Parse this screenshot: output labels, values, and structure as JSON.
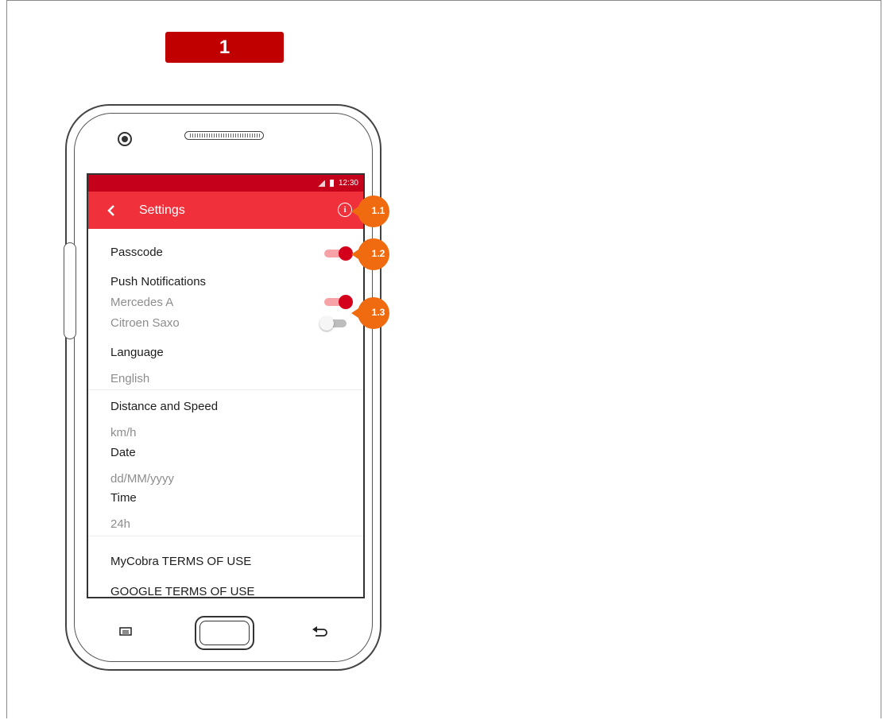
{
  "step_badge": {
    "label": "1"
  },
  "status_bar": {
    "time": "12:30"
  },
  "app_bar": {
    "title": "Settings"
  },
  "settings": {
    "passcode": {
      "label": "Passcode",
      "enabled": true
    },
    "push_notifications": {
      "label": "Push Notifications",
      "vehicles": [
        {
          "name": "Mercedes A",
          "enabled": true
        },
        {
          "name": "Citroen Saxo",
          "enabled": false
        }
      ]
    },
    "language": {
      "label": "Language",
      "value": "English"
    },
    "distance_speed": {
      "label": "Distance and Speed",
      "value": "km/h"
    },
    "date": {
      "label": "Date",
      "value": "dd/MM/yyyy"
    },
    "time": {
      "label": "Time",
      "value": "24h"
    },
    "links": [
      {
        "label": "MyCobra TERMS OF USE"
      },
      {
        "label": "GOOGLE TERMS OF USE"
      }
    ]
  },
  "callouts": [
    {
      "label": "1.1"
    },
    {
      "label": "1.2"
    },
    {
      "label": "1.3"
    }
  ],
  "colors": {
    "accent": "#f0303a",
    "status_bar": "#c4001b",
    "callout": "#f06a0f",
    "badge": "#c00000"
  },
  "icons": {
    "back": "chevron-left-icon",
    "info": "info-icon",
    "menu": "menu-icon",
    "home": "home-button",
    "nav_back": "back-arrow-icon"
  }
}
